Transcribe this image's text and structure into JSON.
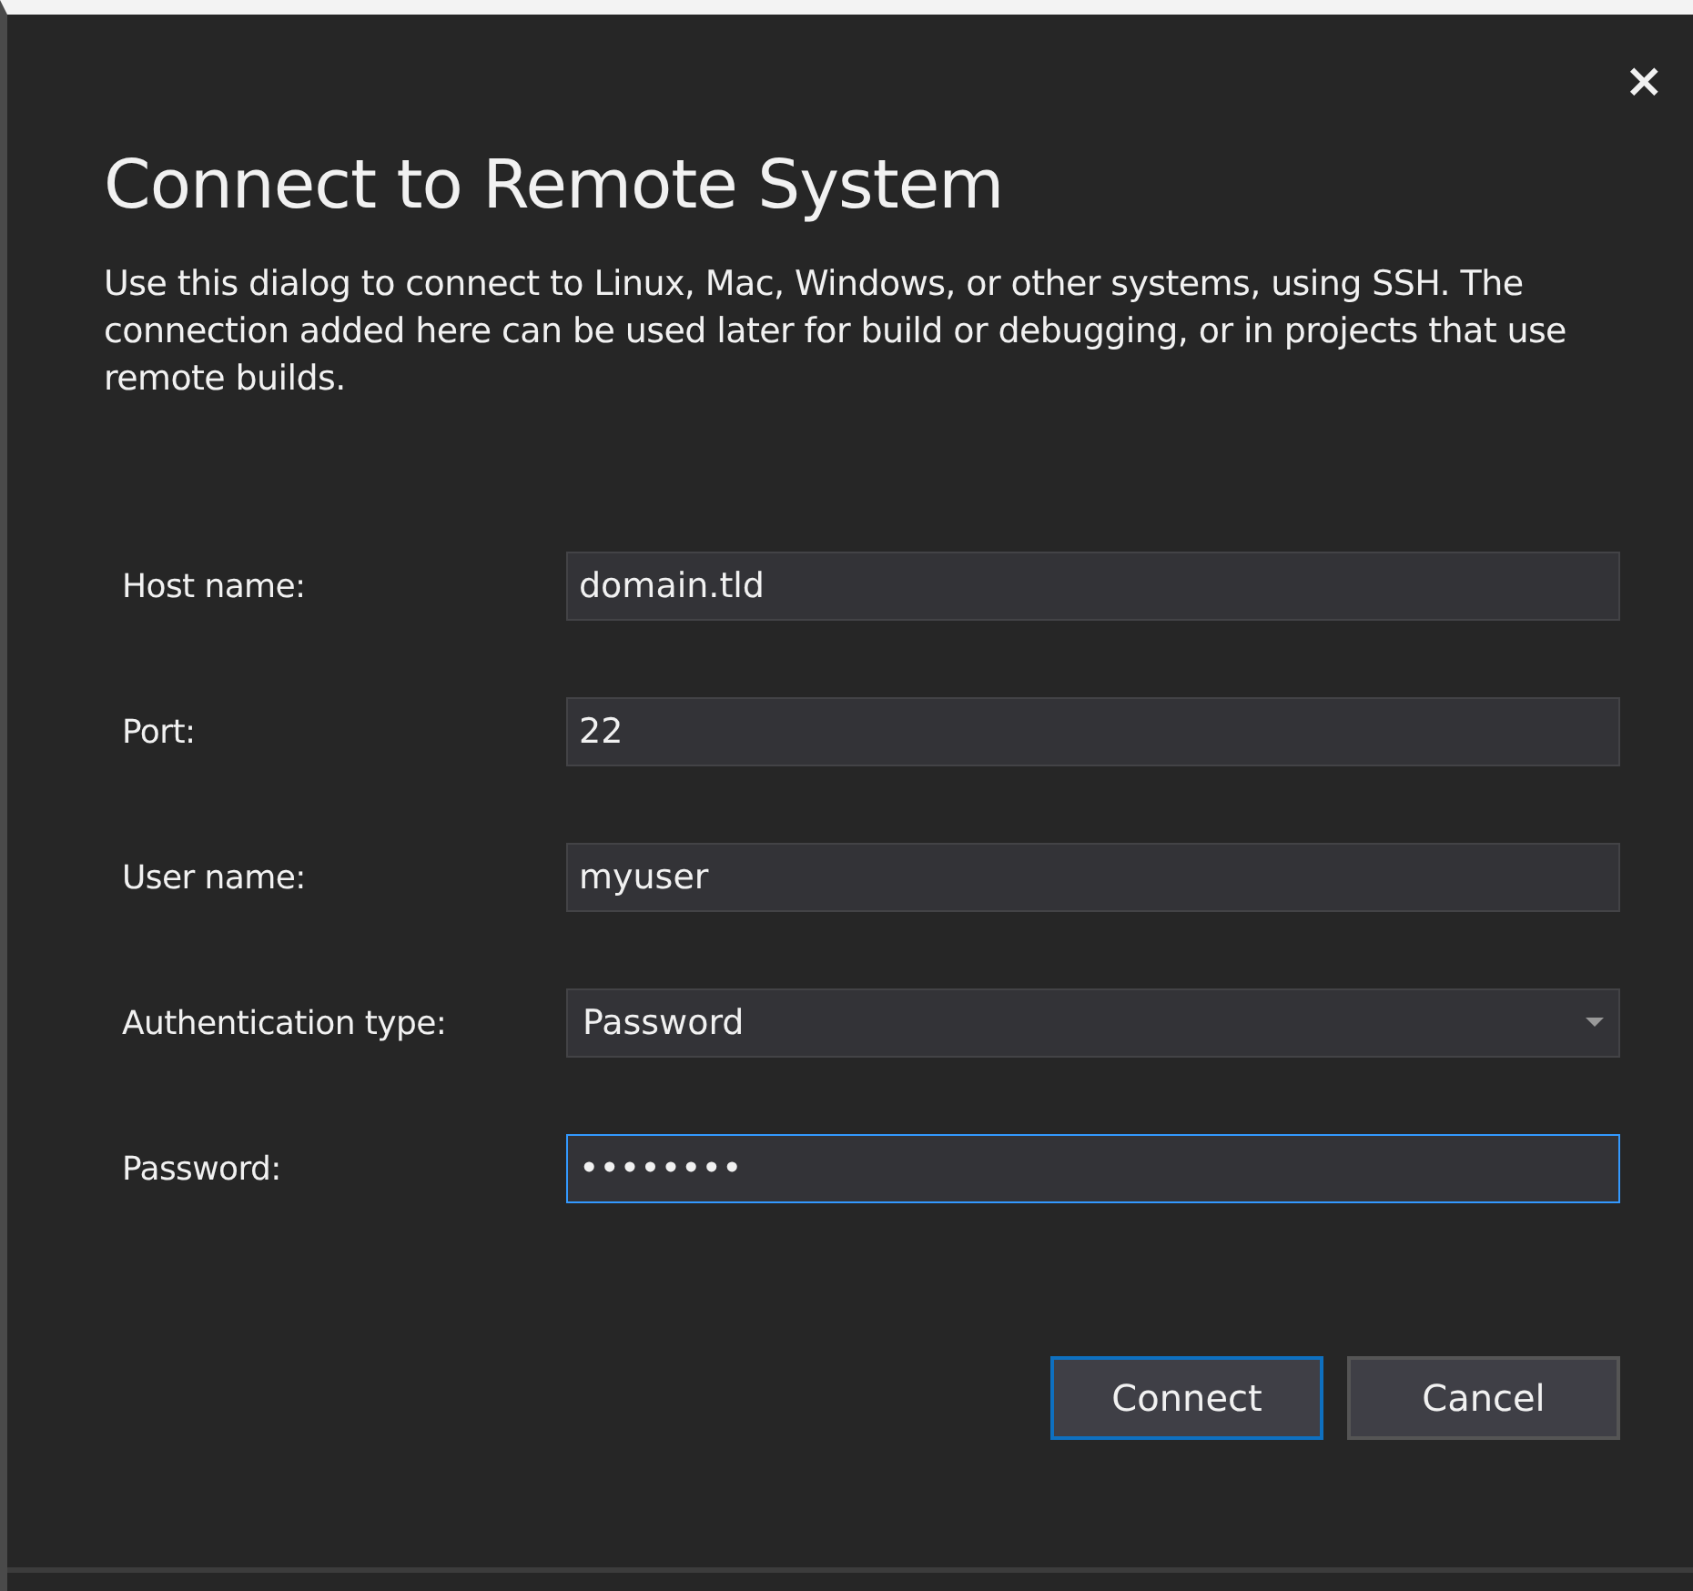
{
  "dialog": {
    "title": "Connect to Remote System",
    "description": "Use this dialog to connect to Linux, Mac, Windows, or other systems, using SSH. The connection added here can be used later for build or debugging, or in projects that use remote builds.",
    "close": "×"
  },
  "fields": [
    {
      "label": "Host name:",
      "kind": "text",
      "value": "domain.tld",
      "focused": false
    },
    {
      "label": "Port:",
      "kind": "text",
      "value": "22",
      "focused": false
    },
    {
      "label": "User name:",
      "kind": "text",
      "value": "myuser",
      "focused": false
    },
    {
      "label": "Authentication type:",
      "kind": "dropdown",
      "value": "Password",
      "focused": false
    },
    {
      "label": "Password:",
      "kind": "password",
      "value": "••••••••",
      "focused": true
    }
  ],
  "buttons": [
    {
      "label": "Connect",
      "default": true
    },
    {
      "label": "Cancel",
      "default": false
    }
  ]
}
